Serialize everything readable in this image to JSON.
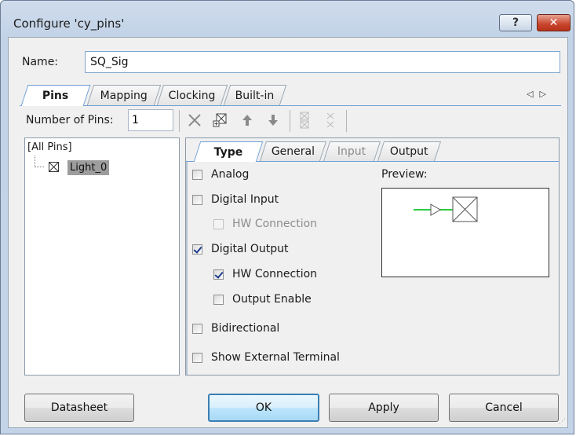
{
  "window": {
    "title": "Configure 'cy_pins'",
    "help_label": "?",
    "close_label": "✕"
  },
  "name": {
    "label": "Name:",
    "value": "SQ_Sig"
  },
  "tabs": [
    {
      "label": "Pins",
      "active": true
    },
    {
      "label": "Mapping"
    },
    {
      "label": "Clocking"
    },
    {
      "label": "Built-in"
    }
  ],
  "tab_scroll": {
    "left": "◁",
    "right": "▷"
  },
  "pins": {
    "label": "Number of Pins:",
    "value": "1"
  },
  "toolbar": {
    "delete_icon": "x-delete-icon",
    "add_icon": "add-pin-icon",
    "up_icon": "arrow-up-icon",
    "down_icon": "arrow-down-icon"
  },
  "tree": {
    "root": "[All Pins]",
    "items": [
      {
        "label": "Light_0"
      }
    ]
  },
  "inner_tabs": [
    {
      "label": "Type",
      "active": true
    },
    {
      "label": "General"
    },
    {
      "label": "Input",
      "disabled": true
    },
    {
      "label": "Output"
    }
  ],
  "type_options": {
    "analog": {
      "label": "Analog",
      "checked": false
    },
    "digital_input": {
      "label": "Digital Input",
      "checked": false
    },
    "di_hw_connection": {
      "label": "HW Connection",
      "checked": false,
      "disabled": true
    },
    "digital_output": {
      "label": "Digital Output",
      "checked": true
    },
    "do_hw_connection": {
      "label": "HW Connection",
      "checked": true
    },
    "output_enable": {
      "label": "Output Enable",
      "checked": false
    },
    "bidirectional": {
      "label": "Bidirectional",
      "checked": false
    },
    "show_external_terminal": {
      "label": "Show External Terminal",
      "checked": false
    }
  },
  "preview": {
    "label": "Preview:"
  },
  "buttons": {
    "datasheet": "Datasheet",
    "ok": "OK",
    "apply": "Apply",
    "cancel": "Cancel"
  },
  "colors": {
    "accent": "#6e9fd6",
    "wire": "#2ecc40",
    "selected_item": "#9d9d9d"
  }
}
